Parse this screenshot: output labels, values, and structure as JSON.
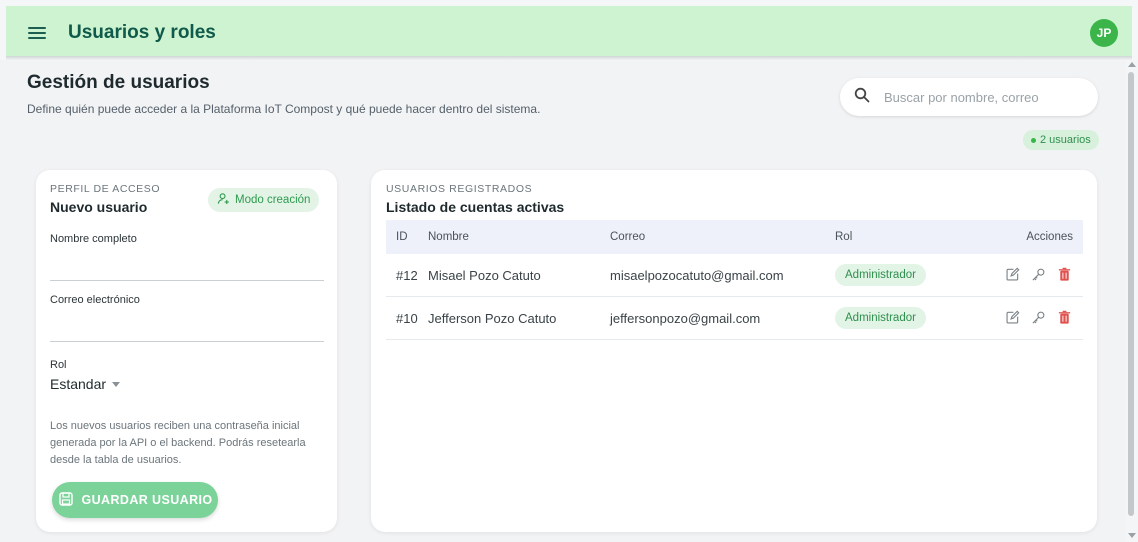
{
  "topbar": {
    "title": "Usuarios y roles",
    "avatar_initials": "JP",
    "menu_icon": "hamburger-icon"
  },
  "header": {
    "title": "Gestión de usuarios",
    "subtitle": "Define quién puede acceder a la Plataforma IoT Compost y qué puede hacer dentro del sistema."
  },
  "search": {
    "placeholder": "Buscar por nombre, correo",
    "value": "",
    "icon": "search-icon"
  },
  "user_count_badge": "2 usuarios",
  "form": {
    "eyebrow": "PERFIL DE ACCESO",
    "title": "Nuevo usuario",
    "mode_chip": "Modo creación",
    "name_label": "Nombre completo",
    "name_value": "",
    "email_label": "Correo electrónico",
    "email_value": "",
    "role_label": "Rol",
    "role_value": "Estandar",
    "help_text": "Los nuevos usuarios reciben una contraseña inicial generada por la API o el backend. Podrás resetearla desde la tabla de usuarios.",
    "save_label": "GUARDAR USUARIO"
  },
  "users": {
    "eyebrow": "USUARIOS REGISTRADOS",
    "title": "Listado de cuentas activas",
    "columns": {
      "id": "ID",
      "name": "Nombre",
      "email": "Correo",
      "role": "Rol",
      "actions": "Acciones"
    },
    "rows": [
      {
        "id": "#12",
        "name": "Misael Pozo Catuto",
        "email": "misaelpozocatuto@gmail.com",
        "role": "Administrador"
      },
      {
        "id": "#10",
        "name": "Jefferson Pozo Catuto",
        "email": "jeffersonpozo@gmail.com",
        "role": "Administrador"
      }
    ]
  },
  "colors": {
    "topbar_bg": "#cdf3d0",
    "brand_green": "#0f5a4a",
    "accent_green": "#3bb54a",
    "delete_red": "#e0524e"
  }
}
